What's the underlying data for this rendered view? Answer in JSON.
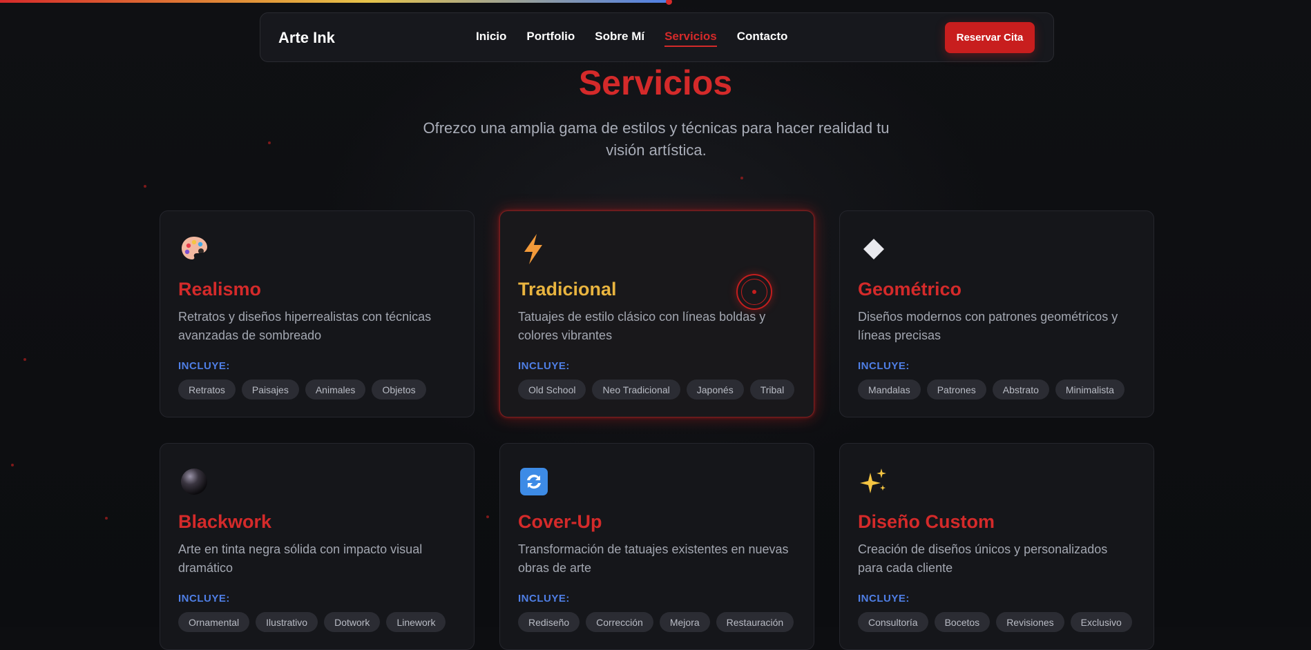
{
  "nav": {
    "brand": "Arte Ink",
    "links": [
      "Inicio",
      "Portfolio",
      "Sobre Mí",
      "Servicios",
      "Contacto"
    ],
    "active_link": "Servicios",
    "cta_label": "Reservar Cita"
  },
  "scroll_progress": 0.51,
  "colors": {
    "accent_red": "#d42a2a",
    "featured_title": "#e9b43f",
    "includes_label": "#4f7fe6",
    "background": "#0d0e11"
  },
  "section": {
    "title": "Servicios",
    "subtitle": "Ofrezco una amplia gama de estilos y técnicas para hacer realidad tu visión artística."
  },
  "services": [
    {
      "icon": "artist-palette-icon",
      "title": "Realismo",
      "description": "Retratos y diseños hiperrealistas con técnicas avanzadas de sombreado",
      "includes_label": "INCLUYE:",
      "tags": [
        "Retratos",
        "Paisajes",
        "Animales",
        "Objetos"
      ]
    },
    {
      "icon": "lightning-icon",
      "title": "Tradicional",
      "description": "Tatuajes de estilo clásico con líneas boldas y colores vibrantes",
      "includes_label": "INCLUYE:",
      "tags": [
        "Old School",
        "Neo Tradicional",
        "Japonés",
        "Tribal"
      ],
      "featured": true
    },
    {
      "icon": "diamond-icon",
      "title": "Geométrico",
      "description": "Diseños modernos con patrones geométricos y líneas precisas",
      "includes_label": "INCLUYE:",
      "tags": [
        "Mandalas",
        "Patrones",
        "Abstrato",
        "Minimalista"
      ]
    },
    {
      "icon": "black-sphere-icon",
      "title": "Blackwork",
      "description": "Arte en tinta negra sólida con impacto visual dramático",
      "includes_label": "INCLUYE:",
      "tags": [
        "Ornamental",
        "Ilustrativo",
        "Dotwork",
        "Linework"
      ]
    },
    {
      "icon": "refresh-icon",
      "title": "Cover-Up",
      "description": "Transformación de tatuajes existentes en nuevas obras de arte",
      "includes_label": "INCLUYE:",
      "tags": [
        "Rediseño",
        "Corrección",
        "Mejora",
        "Restauración"
      ]
    },
    {
      "icon": "sparkles-icon",
      "title": "Diseño Custom",
      "description": "Creación de diseños únicos y personalizados para cada cliente",
      "includes_label": "INCLUYE:",
      "tags": [
        "Consultoría",
        "Bocetos",
        "Revisiones",
        "Exclusivo"
      ]
    }
  ]
}
